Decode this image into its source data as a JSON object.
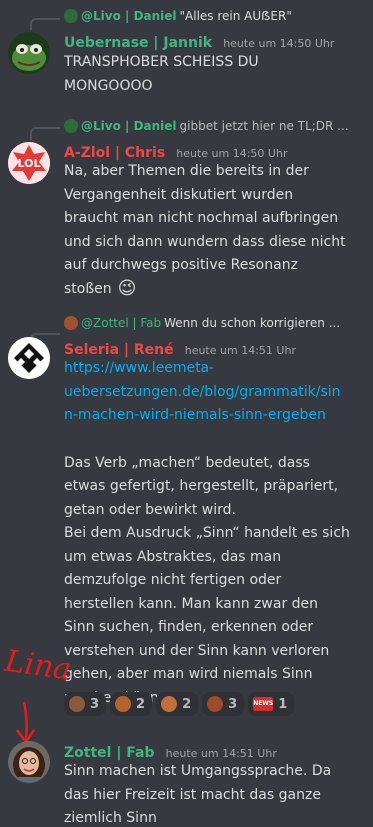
{
  "messages": [
    {
      "reply_author": "@Livo | Daniel",
      "reply_text": "\"Alles rein AUẞER\"",
      "author": "Uebernase | Jannik",
      "author_color": "#43b581",
      "time": "heute um 14:50 Uhr",
      "lines": [
        "TRANSPHOBER SCHEISS DU",
        "MONGOOOO"
      ]
    },
    {
      "reply_author": "@Livo | Daniel",
      "reply_text": "gibbet jetzt hier ne TL;DR ...",
      "author": "A-Zlol | Chris",
      "author_color": "#f04747",
      "time": "heute um 14:50 Uhr",
      "avatar_text": "LOL",
      "lines": [
        "Na, aber Themen die bereits in der",
        "Vergangenheit diskutiert wurden",
        "braucht man nicht nochmal aufbringen",
        "und sich dann wundern dass diese nicht",
        "auf durchwegs positive Resonanz",
        "stoßen"
      ],
      "emoji": "😉"
    },
    {
      "reply_author": "@Zottel | Fab",
      "reply_text": "Wenn du schon korrigieren ...",
      "author": "Seleria | René",
      "author_color": "#f04747",
      "time": "heute um 14:51 Uhr",
      "link_lines": [
        "https://www.leemeta-",
        "uebersetzungen.de/blog/grammatik/sin",
        "n-machen-wird-niemals-sinn-ergeben"
      ],
      "lines": [
        "Das Verb „machen“ bedeutet, dass",
        "etwas gefertigt, hergestellt, präpariert,",
        "getan oder bewirkt wird.",
        "Bei dem Ausdruck „Sinn“ handelt es sich",
        "um etwas Abstraktes, das man",
        "demzufolge nicht fertigen oder",
        "herstellen kann. Man kann zwar den",
        "Sinn suchen, finden, erkennen oder",
        "verstehen und der Sinn kann verloren",
        "gehen, aber man wird niemals Sinn",
        "machen können."
      ],
      "reactions": [
        {
          "emoji": "face-emoji",
          "count": "3"
        },
        {
          "emoji": "animal-emoji",
          "count": "2"
        },
        {
          "emoji": "animal-emoji",
          "count": "2"
        },
        {
          "emoji": "animal-emoji",
          "count": "3"
        },
        {
          "emoji": "news-emoji",
          "label": "NEWS",
          "count": "1"
        }
      ]
    },
    {
      "author": "Zottel | Fab",
      "author_color": "#43b581",
      "time": "heute um 14:51 Uhr",
      "lines": [
        "Sinn machen ist Umgangssprache. Da",
        "das hier Freizeit ist macht das ganze",
        "ziemlich Sinn"
      ]
    }
  ],
  "annotation": {
    "handwritten": "Lina",
    "color": "#e81b1b"
  },
  "colors": {
    "background": "#36393f",
    "reply_livo": "#43b581",
    "reply_zottel": "#43b581",
    "link": "#00b0f4"
  }
}
